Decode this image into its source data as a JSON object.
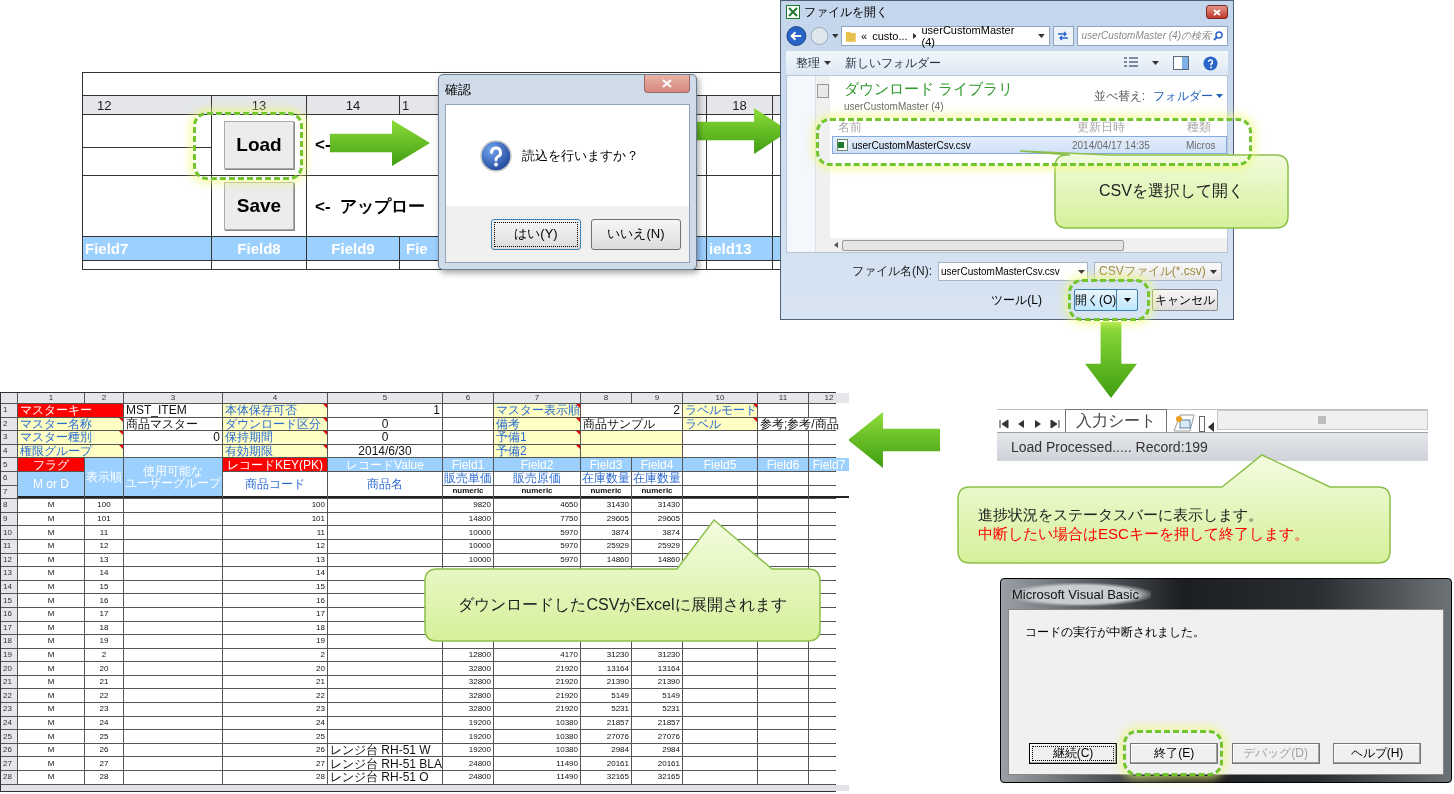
{
  "top_sheet": {
    "columns": [
      "12",
      "13",
      "14",
      "1",
      "18"
    ],
    "buttons": [
      {
        "label": "Load"
      },
      {
        "label": "Save"
      }
    ],
    "notes": [
      "<-",
      "<-  アップロー"
    ],
    "fields": [
      "Field7",
      "Field8",
      "Field9",
      "Fie",
      "ield13"
    ]
  },
  "confirm_dialog": {
    "title": "確認",
    "message": "読込を行いますか？",
    "buttons": [
      {
        "label": "はい(Y)",
        "focused": true
      },
      {
        "label": "いいえ(N)",
        "focused": false
      }
    ]
  },
  "open_dialog": {
    "title": "ファイルを開く",
    "path": [
      "«",
      "custo...",
      "userCustomMaster (4)"
    ],
    "search_placeholder": "userCustomMaster (4)の検索",
    "toolbar": [
      {
        "label": "整理",
        "menu": true
      },
      {
        "label": "新しいフォルダー",
        "menu": false
      }
    ],
    "library_title": "ダウンロード ライブラリ",
    "library_subtitle": "userCustomMaster (4)",
    "sort_label": "並べ替え:",
    "sort_value": "フォルダー",
    "columns": [
      "名前",
      "更新日時",
      "種類"
    ],
    "files": [
      {
        "name": "userCustomMasterCsv.csv",
        "modified": "2014/04/17 14:35",
        "type": "Micros",
        "selected": true
      }
    ],
    "file_name_label": "ファイル名(N):",
    "file_name": "userCustomMasterCsv.csv",
    "file_type": "CSVファイル(*.csv)",
    "tools": "ツール(L)",
    "open": "開く(O)",
    "cancel": "キャンセル"
  },
  "status_panel": {
    "sheet_tabs": [
      {
        "label": "入力シート",
        "selected": true
      }
    ],
    "status_text": "Load Processed..... Record:199"
  },
  "callouts": [
    {
      "lines": [
        {
          "text": "CSVを選択して開く",
          "kind": "normal"
        }
      ]
    },
    {
      "lines": [
        {
          "text": "進捗状況をステータスバーに表示します。",
          "kind": "normal"
        },
        {
          "text": "中断したい場合はESCキーを押して終了します。",
          "kind": "warning"
        }
      ]
    },
    {
      "lines": [
        {
          "text": "ダウンロードしたCSVがExcelに展開されます",
          "kind": "normal"
        }
      ]
    }
  ],
  "vb_dialog": {
    "title": "Microsoft Visual Basic",
    "message": "コードの実行が中断されました。",
    "buttons": [
      {
        "label": "継続(C)",
        "focused": true,
        "disabled": false
      },
      {
        "label": "終了(E)",
        "focused": false,
        "disabled": false
      },
      {
        "label": "デバッグ(D)",
        "focused": false,
        "disabled": true
      },
      {
        "label": "ヘルプ(H)",
        "focused": false,
        "disabled": false
      }
    ]
  },
  "sheet": {
    "columns": [
      "1",
      "2",
      "3",
      "4",
      "5",
      "6",
      "7",
      "8",
      "9",
      "10",
      "11",
      "12"
    ],
    "row_numbers": [
      "1",
      "2",
      "3",
      "4",
      "5",
      "6",
      "7"
    ],
    "header_cells": [
      {
        "text": "マスターキー",
        "kind": "key"
      },
      {
        "text": "MST_ITEM",
        "kind": "value"
      },
      {
        "text": "本体保存可否",
        "kind": "label"
      },
      {
        "text": "1",
        "kind": "value"
      },
      {
        "text": "マスター表示順",
        "kind": "label"
      },
      {
        "text": "2",
        "kind": "value"
      },
      {
        "text": "ラベルモード",
        "kind": "label"
      },
      {
        "text": "マスター名称",
        "kind": "label"
      },
      {
        "text": "商品マスター",
        "kind": "value"
      },
      {
        "text": "ダウンロード区分",
        "kind": "label"
      },
      {
        "text": "0",
        "kind": "value"
      },
      {
        "text": "備考",
        "kind": "label"
      },
      {
        "text": "商品サンプル",
        "kind": "value"
      },
      {
        "text": "ラベル",
        "kind": "label"
      },
      {
        "text": "参考;参考/商品",
        "kind": "value"
      },
      {
        "text": "マスター種別",
        "kind": "label"
      },
      {
        "text": "0",
        "kind": "value"
      },
      {
        "text": "保持期間",
        "kind": "label"
      },
      {
        "text": "0",
        "kind": "value"
      },
      {
        "text": "予備1",
        "kind": "label"
      },
      {
        "text": "権限グループ",
        "kind": "label"
      },
      {
        "text": "有効期限",
        "kind": "label"
      },
      {
        "text": "2014/6/30",
        "kind": "value"
      },
      {
        "text": "予備2",
        "kind": "label"
      },
      {
        "text": "フラグ",
        "kind": "head-red"
      },
      {
        "text": "M or D",
        "kind": "head-blue"
      },
      {
        "text": "表示順",
        "kind": "head-blue"
      },
      {
        "lines": [
          "使用可能な",
          "ユーザーグループ"
        ],
        "kind": "head-blue"
      },
      {
        "text": "レコードKEY(PK)",
        "kind": "head-red"
      },
      {
        "text": "商品コード",
        "kind": "sub"
      },
      {
        "text": "レコードValue",
        "kind": "head-blue"
      },
      {
        "text": "商品名",
        "kind": "sub"
      },
      {
        "text": "Field1",
        "kind": "head-blue"
      },
      {
        "text": "Field2",
        "kind": "head-blue"
      },
      {
        "text": "Field3",
        "kind": "head-blue"
      },
      {
        "text": "Field4",
        "kind": "head-blue"
      },
      {
        "text": "Field5",
        "kind": "head-blue"
      },
      {
        "text": "Field6",
        "kind": "head-blue"
      },
      {
        "text": "Field7",
        "kind": "head-blue"
      },
      {
        "text": "販売単価",
        "kind": "sub"
      },
      {
        "text": "販売原価",
        "kind": "sub"
      },
      {
        "text": "在庫数量",
        "kind": "sub"
      },
      {
        "text": "在庫数量",
        "kind": "sub"
      },
      {
        "text": "numeric",
        "kind": "type"
      },
      {
        "text": "numeric",
        "kind": "type"
      },
      {
        "text": "numeric",
        "kind": "type"
      },
      {
        "text": "numeric",
        "kind": "type"
      }
    ],
    "rows": [
      {
        "row": "8",
        "flag": "M",
        "order": "100",
        "key": "100",
        "fields": [
          "9820",
          "4650",
          "31430",
          "31430"
        ]
      },
      {
        "row": "9",
        "flag": "M",
        "order": "101",
        "key": "101",
        "fields": [
          "14800",
          "7750",
          "29605",
          "29605"
        ]
      },
      {
        "row": "10",
        "flag": "M",
        "order": "11",
        "key": "11",
        "fields": [
          "10000",
          "5970",
          "3874",
          "3874"
        ]
      },
      {
        "row": "11",
        "flag": "M",
        "order": "12",
        "key": "12",
        "fields": [
          "10000",
          "5970",
          "25929",
          "25929"
        ]
      },
      {
        "row": "12",
        "flag": "M",
        "order": "13",
        "key": "13",
        "fields": [
          "10000",
          "5970",
          "14860",
          "14860"
        ]
      },
      {
        "row": "13",
        "flag": "M",
        "order": "14",
        "key": "14"
      },
      {
        "row": "14",
        "flag": "M",
        "order": "15",
        "key": "15"
      },
      {
        "row": "15",
        "flag": "M",
        "order": "16",
        "key": "16"
      },
      {
        "row": "16",
        "flag": "M",
        "order": "17",
        "key": "17"
      },
      {
        "row": "17",
        "flag": "M",
        "order": "18",
        "key": "18"
      },
      {
        "row": "18",
        "flag": "M",
        "order": "19",
        "key": "19"
      },
      {
        "row": "19",
        "flag": "M",
        "order": "2",
        "key": "2",
        "fields": [
          "12800",
          "4170",
          "31230",
          "31230"
        ]
      },
      {
        "row": "20",
        "flag": "M",
        "order": "20",
        "key": "20",
        "fields": [
          "32800",
          "21920",
          "13164",
          "13164"
        ]
      },
      {
        "row": "21",
        "flag": "M",
        "order": "21",
        "key": "21",
        "fields": [
          "32800",
          "21920",
          "21390",
          "21390"
        ]
      },
      {
        "row": "22",
        "flag": "M",
        "order": "22",
        "key": "22",
        "fields": [
          "32800",
          "21920",
          "5149",
          "5149"
        ]
      },
      {
        "row": "23",
        "flag": "M",
        "order": "23",
        "key": "23",
        "fields": [
          "32800",
          "21920",
          "5231",
          "5231"
        ]
      },
      {
        "row": "24",
        "flag": "M",
        "order": "24",
        "key": "24",
        "fields": [
          "19200",
          "10380",
          "21857",
          "21857"
        ]
      },
      {
        "row": "25",
        "flag": "M",
        "order": "25",
        "key": "25",
        "fields": [
          "19200",
          "10380",
          "27076",
          "27076"
        ]
      },
      {
        "row": "26",
        "flag": "M",
        "order": "26",
        "key": "26",
        "name": "レンジ台 RH-51 W",
        "fields": [
          "19200",
          "10380",
          "2984",
          "2984"
        ]
      },
      {
        "row": "27",
        "flag": "M",
        "order": "27",
        "key": "27",
        "name": "レンジ台 RH-51 BLA",
        "fields": [
          "24800",
          "11490",
          "20161",
          "20161"
        ]
      },
      {
        "row": "28",
        "flag": "M",
        "order": "28",
        "key": "28",
        "name": "レンジ台 RH-51 O",
        "fields": [
          "24800",
          "11490",
          "32165",
          "32165"
        ]
      }
    ]
  }
}
